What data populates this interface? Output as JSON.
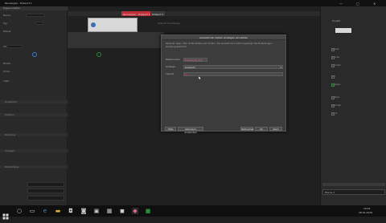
{
  "window": {
    "title": "Renoargen - Entwurf 1",
    "controls": {
      "minimize": "—",
      "maximize": "▢",
      "close": "✕"
    }
  },
  "canvas": {
    "tabs": [
      {
        "label": "Renoargen - Entwurf 1"
      },
      {
        "label": "Entwurf 1"
      }
    ],
    "hint_text": "Ansicht Fluchtweg"
  },
  "dialog": {
    "title": "Auswahl der Option anzeigen ein ladder",
    "description_line1": "Optionen legen. Hier rechts-klicken zum ändern. Die Auswahl wird sofort angezeigt. Die Einstellungen",
    "description_line2": "werden gespeichert.",
    "fields": [
      {
        "label": "Datenname",
        "value": "Planlnhalt_123"
      },
      {
        "label": "Anzeige",
        "value": "Auswahl"
      },
      {
        "label": "Layout",
        "value": ""
      }
    ],
    "buttons": {
      "left1": "Hilfe",
      "left2": "Standard anwenden",
      "ok": "Ok",
      "cancel": "Abbrechen",
      "apply": "Start"
    }
  },
  "left_panel": {
    "header": "Eigenschaften",
    "rows": [
      {
        "label": "Name"
      },
      {
        "label": "Typ"
      },
      {
        "label": "Ebene"
      },
      {
        "label": "Farbe"
      },
      {
        "label": "Breite"
      },
      {
        "label": "Höhe"
      },
      {
        "label": "Tiefe"
      }
    ],
    "sections": [
      "Zusätzlich",
      "Position",
      "Drehung",
      "Anzeige",
      "Darstellung"
    ]
  },
  "right_panel": {
    "header": "Projekt",
    "items": [
      "Wand",
      "Decke",
      "Fenster",
      "Tür",
      "Treppe",
      "Möbel",
      "Bemaß.",
      "Text"
    ],
    "footer_input": "Ebene 1"
  },
  "taskbar": {
    "clock_time": "16:51",
    "clock_date": "28.01.2019"
  },
  "colors": {
    "accent_red": "#c0303a",
    "accent_green": "#2a8a3a",
    "selection_pink": "#e06a8a"
  }
}
